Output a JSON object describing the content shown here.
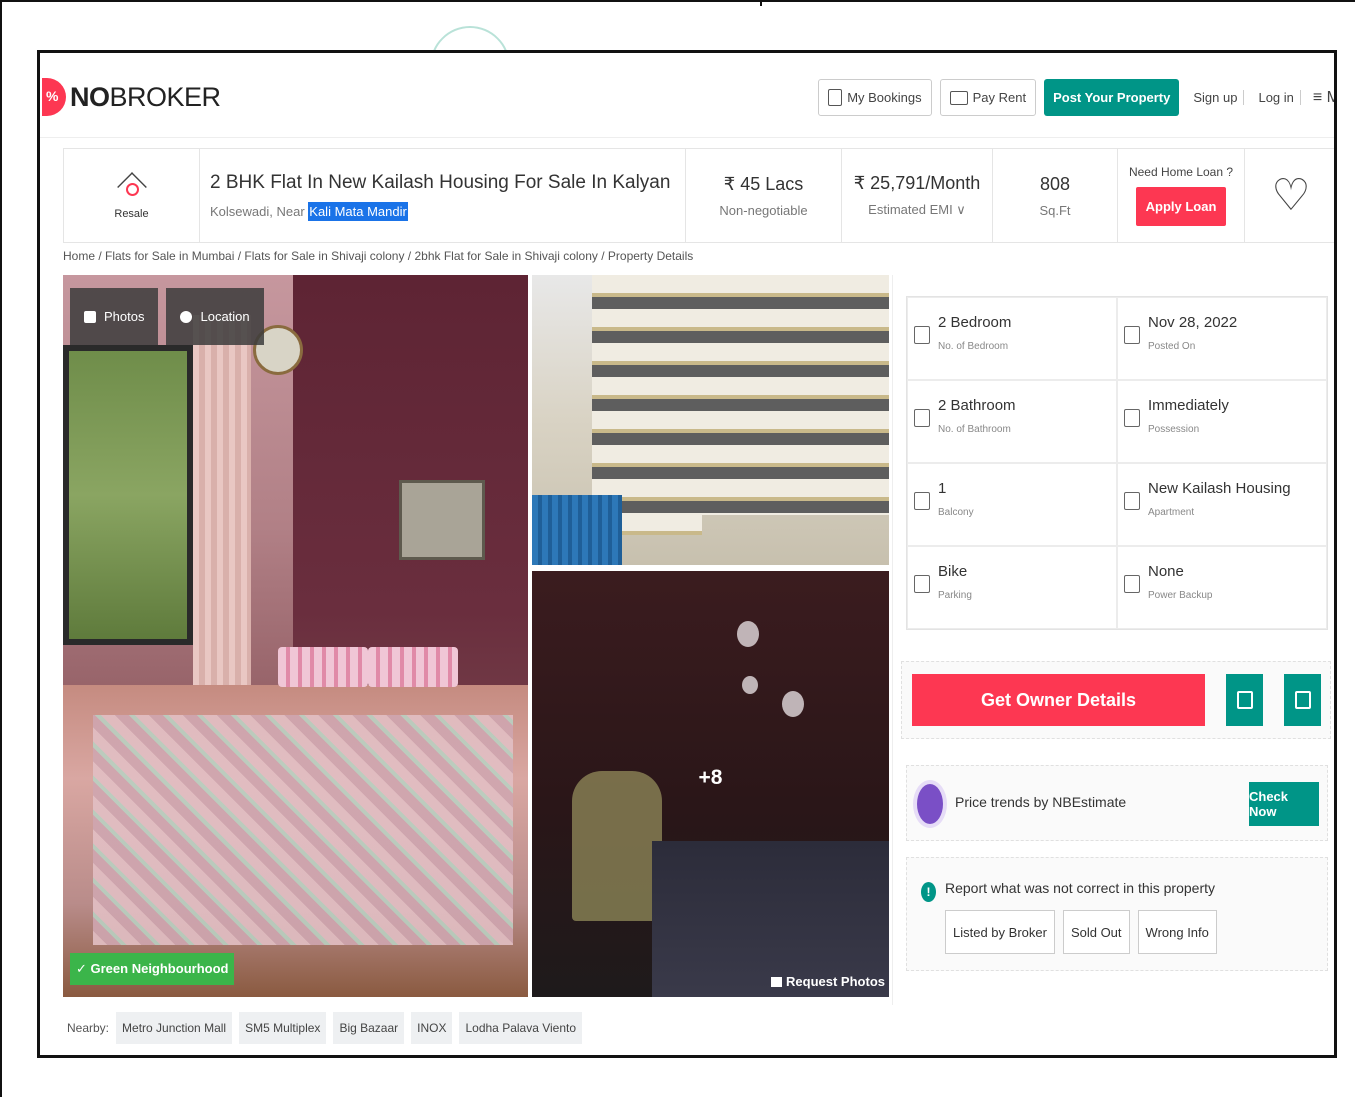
{
  "brand": {
    "logo_strong": "NO",
    "logo_rest": "BROKER",
    "accent": "#fd3752",
    "teal": "#009587"
  },
  "nav": {
    "my_bookings": "My Bookings",
    "pay_rent": "Pay Rent",
    "post_property": "Post Your Property",
    "sign_up": "Sign up",
    "log_in": "Log in",
    "menu_label": "M"
  },
  "summary": {
    "resale_label": "Resale",
    "title": "2 BHK Flat In New Kailash Housing For Sale In Kalyan",
    "address_prefix": "Kolsewadi, Near ",
    "address_highlight": "Kali Mata Mandir",
    "price_value": "₹ 45 Lacs",
    "price_label": "Non-negotiable",
    "emi_value": "₹ 25,791/Month",
    "emi_label": "Estimated EMI ∨",
    "area_value": "808",
    "area_label": "Sq.Ft",
    "loan_question": "Need Home Loan ?",
    "loan_button": "Apply Loan"
  },
  "breadcrumb": "Home / Flats for Sale in Mumbai / Flats for Sale in Shivaji colony / 2bhk Flat for Sale in Shivaji colony / Property Details",
  "gallery": {
    "photos_btn": "Photos",
    "location_btn": "Location",
    "green_badge": "Green Neighbourhood",
    "more_count": "+8",
    "request_photos": "Request Photos"
  },
  "nearby": {
    "label": "Nearby:",
    "places": [
      "Metro Junction Mall",
      "SM5 Multiplex",
      "Big Bazaar",
      "INOX",
      "Lodha Palava Viento"
    ]
  },
  "details": [
    {
      "value": "2 Bedroom",
      "label": "No. of Bedroom",
      "icon": "bed-icon"
    },
    {
      "value": "Nov 28, 2022",
      "label": "Posted On",
      "icon": "calendar-icon"
    },
    {
      "value": "2 Bathroom",
      "label": "No. of Bathroom",
      "icon": "bath-icon"
    },
    {
      "value": "Immediately",
      "label": "Possession",
      "icon": "key-icon"
    },
    {
      "value": "1",
      "label": "Balcony",
      "icon": "balcony-icon"
    },
    {
      "value": "New Kailash Housing",
      "label": "Apartment",
      "icon": "building-icon"
    },
    {
      "value": "Bike",
      "label": "Parking",
      "icon": "car-icon"
    },
    {
      "value": "None",
      "label": "Power Backup",
      "icon": "battery-icon"
    }
  ],
  "actions": {
    "owner_button": "Get Owner Details",
    "trend_text": "Price trends by NBEstimate",
    "check_now": "Check Now",
    "report_text": "Report what was not correct in this property",
    "report_options": [
      "Listed by Broker",
      "Sold Out",
      "Wrong Info"
    ]
  }
}
